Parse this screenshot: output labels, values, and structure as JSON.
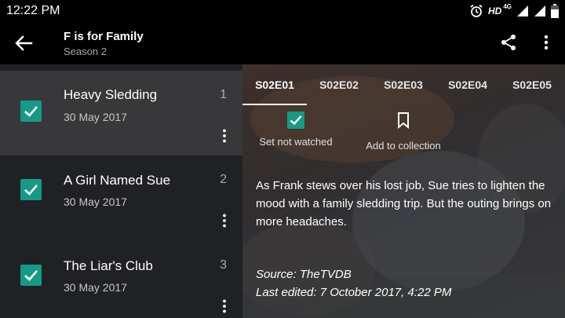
{
  "status_bar": {
    "time": "12:22 PM",
    "hd": "HD",
    "network": "4G"
  },
  "app_bar": {
    "title": "F is for Family",
    "subtitle": "Season 2"
  },
  "episodes": [
    {
      "title": "Heavy Sledding",
      "date": "30 May 2017",
      "number": "1",
      "watched": true,
      "selected": true
    },
    {
      "title": "A Girl Named Sue",
      "date": "30 May 2017",
      "number": "2",
      "watched": true,
      "selected": false
    },
    {
      "title": "The Liar's Club",
      "date": "30 May 2017",
      "number": "3",
      "watched": true,
      "selected": false
    }
  ],
  "tabs": [
    "S02E01",
    "S02E02",
    "S02E03",
    "S02E04",
    "S02E05"
  ],
  "active_tab": "S02E01",
  "actions": {
    "watched_label": "Set not watched",
    "collection_label": "Add to collection"
  },
  "detail": {
    "description": "As Frank stews over his lost job, Sue tries to lighten the mood with a family sledding trip. But the outing brings on more headaches.",
    "source": "Source: TheTVDB",
    "last_edited": "Last edited: 7 October 2017, 4:22 PM"
  },
  "colors": {
    "accent": "#159b85",
    "list_bg": "#202124",
    "selected_bg": "#38383a"
  },
  "icons": {
    "back": "arrow-left-icon",
    "share": "share-icon",
    "overflow": "more-vert-icon",
    "bookmark": "bookmark-icon",
    "check": "checkbox-icon"
  }
}
